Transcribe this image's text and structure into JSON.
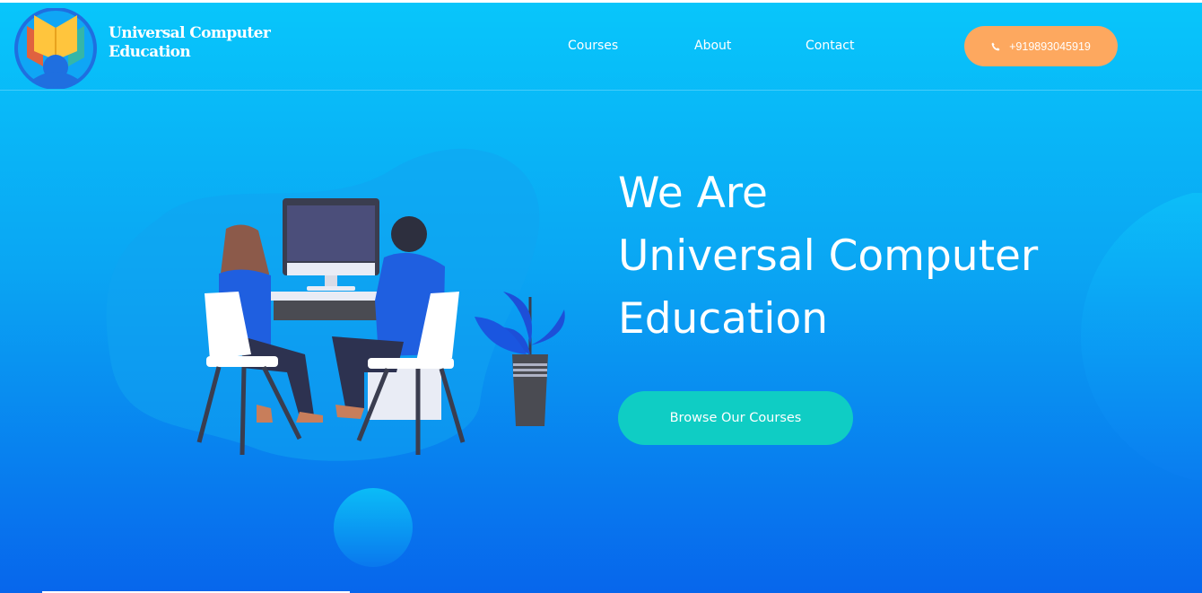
{
  "brand": {
    "line1": "Universal Computer",
    "line2": "Education",
    "logo_icon": "book-person-logo-icon"
  },
  "nav": {
    "items": [
      {
        "label": "Courses"
      },
      {
        "label": "About"
      },
      {
        "label": "Contact"
      }
    ],
    "phone": {
      "label": "+919893045919",
      "icon": "phone-icon"
    }
  },
  "hero": {
    "title_line1": "We Are",
    "title_line2": "Universal Computer",
    "title_line3": "Education",
    "cta_label": "Browse Our Courses"
  },
  "colors": {
    "bg_top": "#08c6fb",
    "bg_bottom": "#0766ec",
    "phone_button": "#fda85f",
    "cta_button": "#0fcdc4"
  }
}
